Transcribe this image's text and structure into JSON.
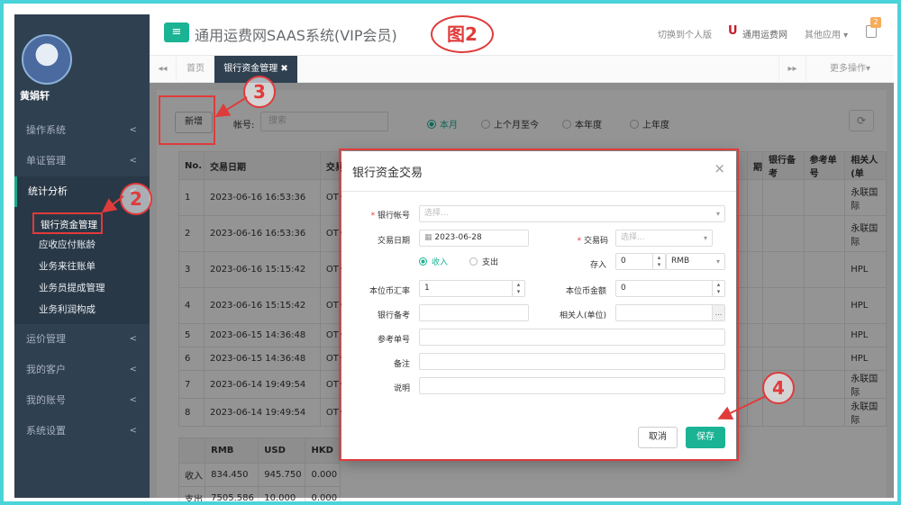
{
  "sidebar": {
    "user_name": "黄娟轩",
    "menu": [
      {
        "label": "操作系统",
        "chevron": "<"
      },
      {
        "label": "单证管理",
        "chevron": "<"
      },
      {
        "label": "统计分析",
        "chevron": "<"
      }
    ],
    "submenu": [
      "银行资金管理",
      "应收应付账龄",
      "业务来往账单",
      "业务员提成管理",
      "业务利润构成"
    ],
    "menu_after": [
      {
        "label": "运价管理",
        "chevron": "<"
      },
      {
        "label": "我的客户",
        "chevron": "<"
      },
      {
        "label": "我的账号",
        "chevron": "<"
      },
      {
        "label": "系统设置",
        "chevron": "<"
      }
    ]
  },
  "header": {
    "toggle_icon": "≡",
    "title": "通用运费网SAAS系统(VIP会员)",
    "figure_label": "图2",
    "switch_personal": "切换到个人版",
    "brand_letter": "U",
    "brand_name": "通用运费网",
    "other_apps": "其他应用 ▾",
    "notification_count": "2"
  },
  "tabs": {
    "back": "◂◂",
    "home": "首页",
    "active": "银行资金管理 ✖",
    "forward": "▸▸",
    "more": "更多操作▾"
  },
  "toolbar": {
    "add": "新增",
    "account_label": "帐号:",
    "account_placeholder": "搜索",
    "radios": [
      "本月",
      "上个月至今",
      "本年度",
      "上年度"
    ],
    "refresh": "⟳"
  },
  "table": {
    "headers": [
      "No.",
      "交易日期",
      "交易",
      "",
      "",
      "",
      "",
      "",
      "",
      "",
      "",
      "",
      "期",
      "银行备考",
      "参考单号",
      "相关人(单"
    ],
    "rows": [
      {
        "no": "1",
        "date": "2023-06-16 16:53:36",
        "type": "OTH",
        "related": "永联国际"
      },
      {
        "no": "2",
        "date": "2023-06-16 16:53:36",
        "type": "OTH",
        "related": "永联国际"
      },
      {
        "no": "3",
        "date": "2023-06-16 15:15:42",
        "type": "OTH",
        "related": "HPL"
      },
      {
        "no": "4",
        "date": "2023-06-16 15:15:42",
        "type": "OTH",
        "related": "HPL"
      },
      {
        "no": "5",
        "date": "2023-06-15 14:36:48",
        "type": "OTH",
        "related": "HPL"
      },
      {
        "no": "6",
        "date": "2023-06-15 14:36:48",
        "type": "OTH",
        "related": "HPL"
      },
      {
        "no": "7",
        "date": "2023-06-14 19:49:54",
        "type": "OTH",
        "related": "永联国际"
      },
      {
        "no": "8",
        "date": "2023-06-14 19:49:54",
        "type": "OTH",
        "related": "永联国际"
      }
    ]
  },
  "summary": {
    "headers": [
      "",
      "RMB",
      "USD",
      "HKD"
    ],
    "rows": [
      [
        "收入",
        "834.450",
        "945.750",
        "0.000"
      ],
      [
        "支出",
        "7505.586",
        "10.000",
        "0.000"
      ]
    ]
  },
  "modal": {
    "title": "银行资金交易",
    "close": "×",
    "bank_account_label": "银行帐号",
    "bank_account_placeholder": "选择...",
    "date_label": "交易日期",
    "date_value": "2023-06-28",
    "code_label": "交易码",
    "code_placeholder": "选择...",
    "radio_income": "收入",
    "radio_expense": "支出",
    "deposit_label": "存入",
    "deposit_value": "0",
    "currency_value": "RMB",
    "rate_label": "本位币汇率",
    "rate_value": "1",
    "amount_label": "本位币金额",
    "amount_value": "0",
    "bank_note_label": "银行备考",
    "related_label": "相关人(单位)",
    "related_button": "...",
    "ref_label": "参考单号",
    "remark_label": "备注",
    "desc_label": "说明",
    "cancel": "取消",
    "save": "保存",
    "required_mark": "*"
  },
  "annotations": [
    "2",
    "3",
    "4"
  ],
  "colors": {
    "accent": "#1ab394",
    "sidebar": "#2f4050",
    "annotation": "#e03b3b",
    "frame": "#4ad3d8"
  }
}
